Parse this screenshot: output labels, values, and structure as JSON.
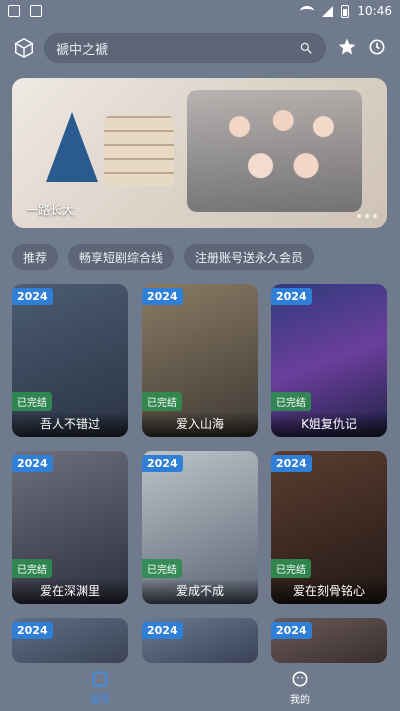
{
  "status_bar": {
    "time": "10:46",
    "icons": [
      "notification-icon",
      "image-icon",
      "wifi-icon",
      "signal-icon",
      "battery-icon"
    ]
  },
  "top_bar": {
    "search_text": "褫中之褫",
    "icons": [
      "cube-icon",
      "search-icon",
      "star-icon",
      "history-icon"
    ]
  },
  "banner": {
    "title": "一路长大"
  },
  "chips": [
    "推荐",
    "畅享短剧综合线",
    "注册账号送永久会员"
  ],
  "cards": [
    {
      "year": "2024",
      "status": "已完结",
      "title": "吾人不错过"
    },
    {
      "year": "2024",
      "status": "已完结",
      "title": "爱入山海"
    },
    {
      "year": "2024",
      "status": "已完结",
      "title": "K姐复仇记"
    },
    {
      "year": "2024",
      "status": "已完结",
      "title": "爱在深渊里"
    },
    {
      "year": "2024",
      "status": "已完结",
      "title": "爱成不成"
    },
    {
      "year": "2024",
      "status": "已完结",
      "title": "爱在刻骨铭心"
    },
    {
      "year": "2024"
    },
    {
      "year": "2024"
    },
    {
      "year": "2024"
    }
  ],
  "bottom_nav": [
    {
      "label": "首页",
      "icon": "home-icon"
    },
    {
      "label": "我的",
      "icon": "user-icon"
    }
  ],
  "colors": {
    "background": "#6f7a8c",
    "accent": "#3a8ef0",
    "year_badge": "#2f7fd6",
    "status_badge": "#308c50"
  }
}
